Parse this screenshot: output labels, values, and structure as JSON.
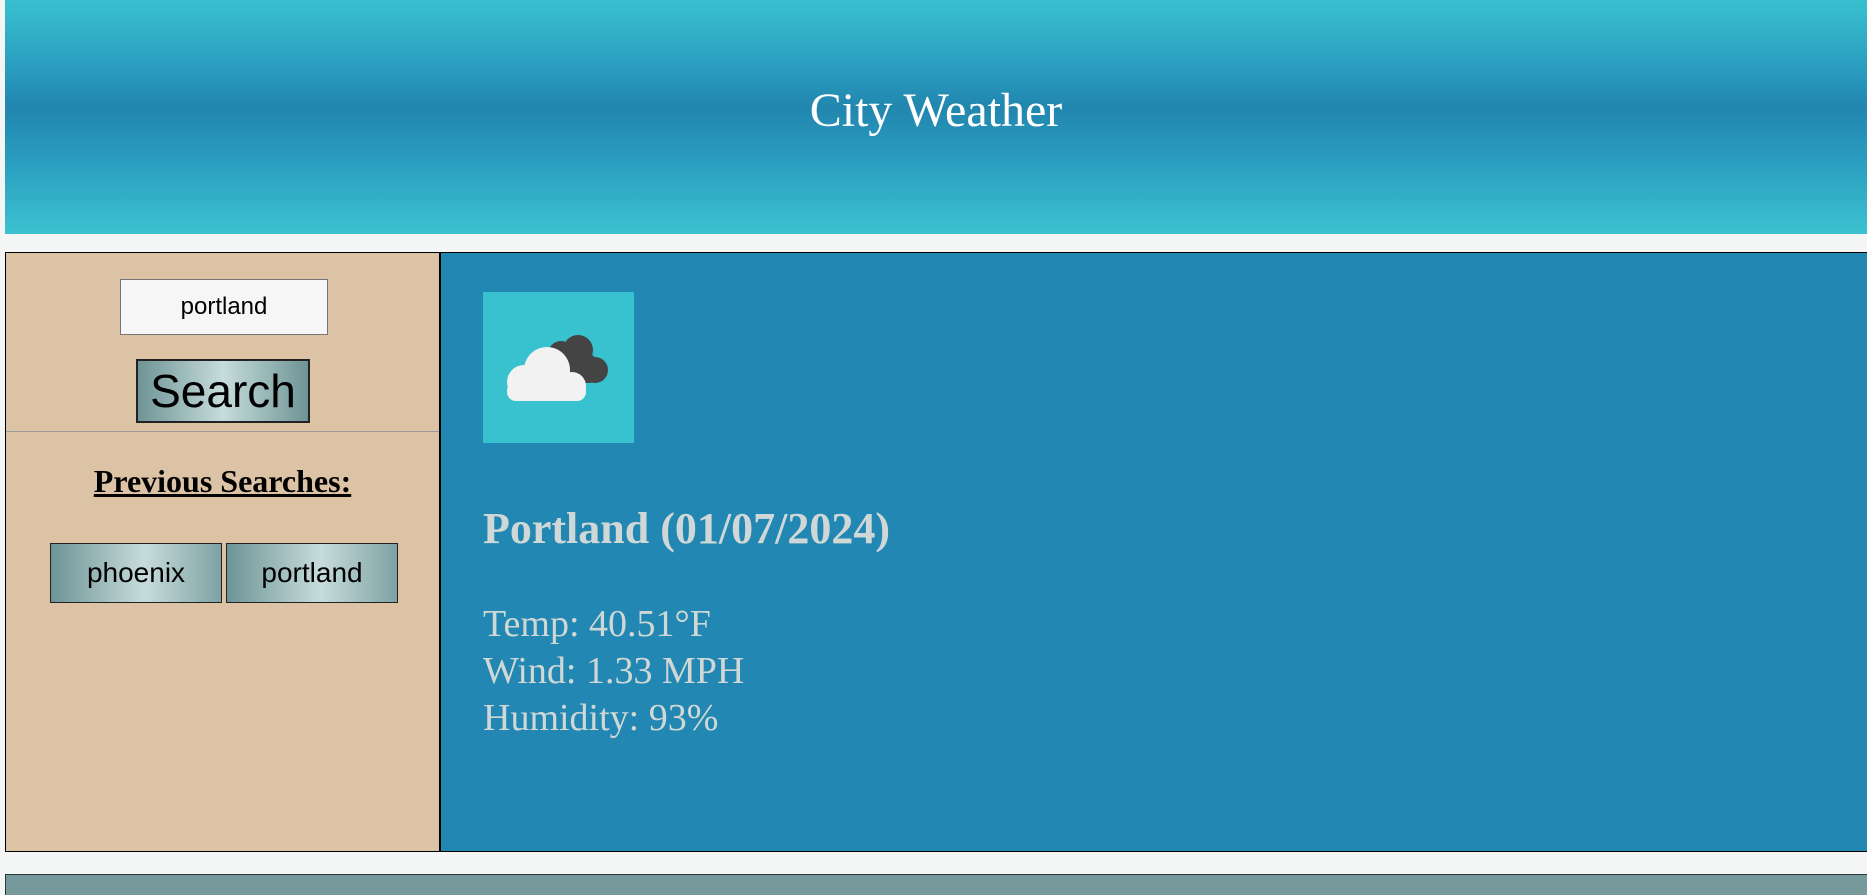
{
  "header": {
    "title": "City Weather"
  },
  "search": {
    "input_value": "portland",
    "button_label": "Search"
  },
  "history": {
    "title": "Previous Searches:",
    "items": [
      "phoenix",
      "portland"
    ]
  },
  "weather": {
    "icon": "cloudy-icon",
    "city_date": "Portland (01/07/2024)",
    "temp": "Temp: 40.51°F",
    "wind": "Wind: 1.33 MPH",
    "humidity": "Humidity: 93%"
  },
  "colors": {
    "header_mid": "#2286ae",
    "header_edge": "#38c0cf",
    "sidebar_bg": "#dcc3a5",
    "main_bg": "#2287b2",
    "icon_bg": "#38c2d0",
    "footer_bg": "#769a9b"
  }
}
